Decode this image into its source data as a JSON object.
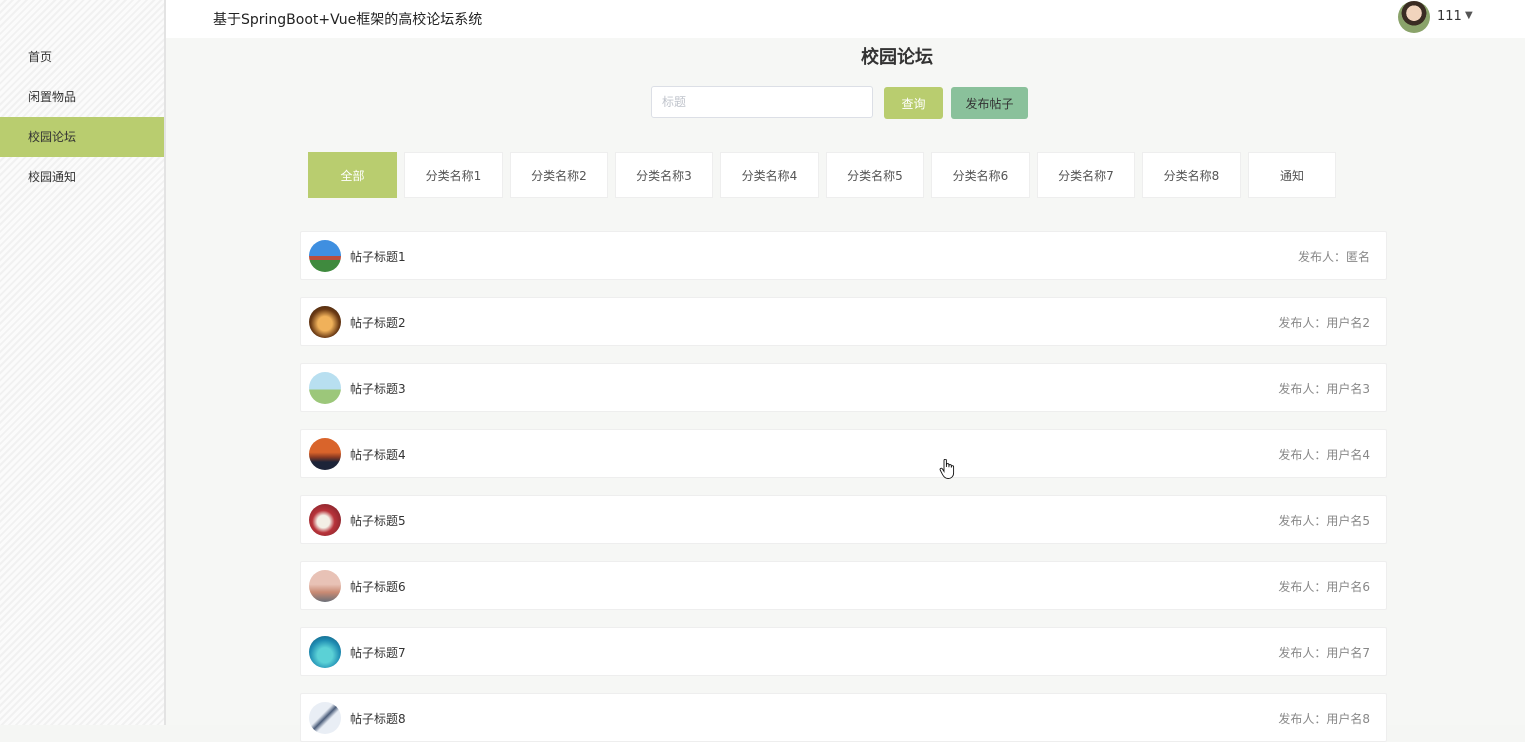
{
  "sidebar": {
    "items": [
      {
        "label": "首页"
      },
      {
        "label": "闲置物品"
      },
      {
        "label": "校园论坛"
      },
      {
        "label": "校园通知"
      }
    ]
  },
  "header": {
    "system_title": "基于SpringBoot+Vue框架的高校论坛系统",
    "username": "111",
    "caret": "▼"
  },
  "page": {
    "title": "校园论坛"
  },
  "search": {
    "placeholder": "标题",
    "value": "",
    "query_label": "查询",
    "post_label": "发布帖子"
  },
  "tabs": [
    {
      "label": "全部"
    },
    {
      "label": "分类名称1"
    },
    {
      "label": "分类名称2"
    },
    {
      "label": "分类名称3"
    },
    {
      "label": "分类名称4"
    },
    {
      "label": "分类名称5"
    },
    {
      "label": "分类名称6"
    },
    {
      "label": "分类名称7"
    },
    {
      "label": "分类名称8"
    },
    {
      "label": "通知"
    }
  ],
  "posts": [
    {
      "title": "帖子标题1",
      "author_label": "发布人：",
      "author": "匿名"
    },
    {
      "title": "帖子标题2",
      "author_label": "发布人：",
      "author": "用户名2"
    },
    {
      "title": "帖子标题3",
      "author_label": "发布人：",
      "author": "用户名3"
    },
    {
      "title": "帖子标题4",
      "author_label": "发布人：",
      "author": "用户名4"
    },
    {
      "title": "帖子标题5",
      "author_label": "发布人：",
      "author": "用户名5"
    },
    {
      "title": "帖子标题6",
      "author_label": "发布人：",
      "author": "用户名6"
    },
    {
      "title": "帖子标题7",
      "author_label": "发布人：",
      "author": "用户名7"
    },
    {
      "title": "帖子标题8",
      "author_label": "发布人：",
      "author": "用户名8"
    }
  ],
  "colors": {
    "accent": "#b9cd6f",
    "post_button": "#8ac19b"
  }
}
